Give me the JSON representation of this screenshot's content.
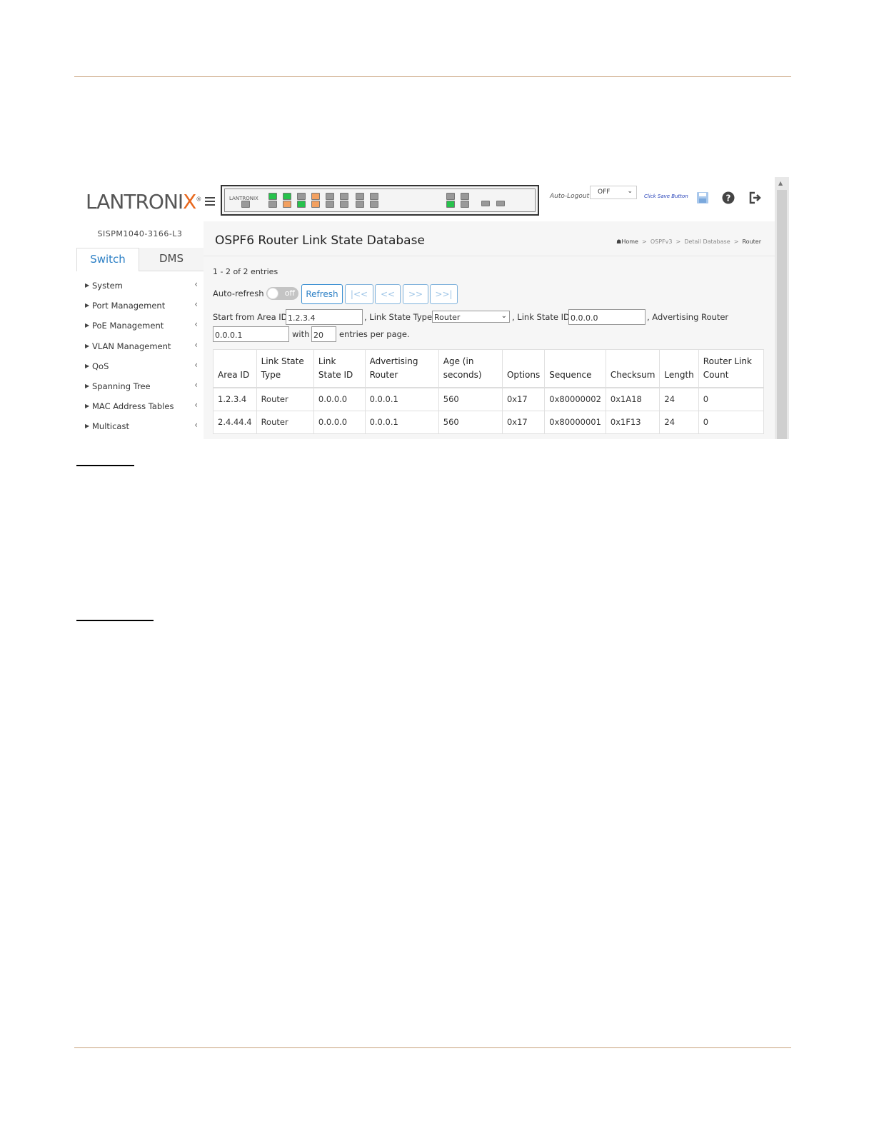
{
  "header": {
    "logo_main": "LANTRONI",
    "logo_x": "X",
    "logo_reg": "®",
    "panel_logo": "LANTRONIX",
    "auto_logout_label": "Auto-Logout",
    "auto_logout_value": "OFF",
    "save_hint": "Click Save Button"
  },
  "sidebar": {
    "device_name": "SISPM1040-3166-L3",
    "tabs": [
      "Switch",
      "DMS"
    ],
    "items": [
      "System",
      "Port Management",
      "PoE Management",
      "VLAN Management",
      "QoS",
      "Spanning Tree",
      "MAC Address Tables",
      "Multicast"
    ]
  },
  "main": {
    "title": "OSPF6 Router Link State Database",
    "breadcrumb": [
      "Home",
      "OSPFv3",
      "Detail Database",
      "Router"
    ],
    "entries": "1 - 2 of 2 entries",
    "auto_refresh_label": "Auto-refresh",
    "toggle_text": "off",
    "buttons": {
      "refresh": "Refresh",
      "first": "|<<",
      "prev": "<<",
      "next": ">>",
      "last": ">>|"
    },
    "filter": {
      "start_label": "Start from Area ID",
      "area_id": "1.2.3.4",
      "lst_label": ", Link State Type",
      "lst_value": "Router",
      "lsid_label": ", Link State ID",
      "lsid_value": "0.0.0.0",
      "adv_label": ", Advertising Router",
      "adv_value": "0.0.0.1",
      "with_label": "with",
      "per_page": "20",
      "per_page_label": "entries per page."
    },
    "table": {
      "headers": [
        "Area ID",
        "Link State Type",
        "Link State ID",
        "Advertising Router",
        "Age (in seconds)",
        "Options",
        "Sequence",
        "Checksum",
        "Length",
        "Router Link Count"
      ],
      "rows": [
        [
          "1.2.3.4",
          "Router",
          "0.0.0.0",
          "0.0.0.1",
          "560",
          "0x17",
          "0x80000002",
          "0x1A18",
          "24",
          "0"
        ],
        [
          "2.4.44.4",
          "Router",
          "0.0.0.0",
          "0.0.0.1",
          "560",
          "0x17",
          "0x80000001",
          "0x1F13",
          "24",
          "0"
        ]
      ]
    }
  },
  "colors": {
    "accent": "#2b7fc5",
    "rule": "#c8a27c",
    "port_green": "#27c24c",
    "port_orange": "#f2a060"
  }
}
